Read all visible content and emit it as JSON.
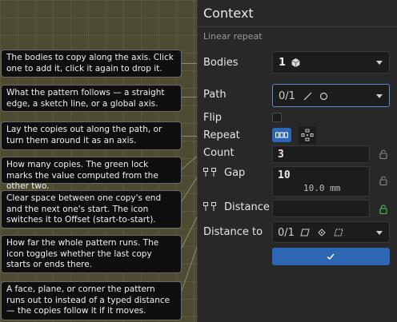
{
  "panel": {
    "title": "Context",
    "subtitle": "Linear repeat"
  },
  "rows": {
    "bodies_label": "Bodies",
    "bodies_value": "1",
    "path_label": "Path",
    "path_value": "0/1",
    "flip_label": "Flip",
    "repeat_label": "Repeat",
    "count_label": "Count",
    "count_value": "3",
    "gap_label": "Gap",
    "gap_value": "10",
    "gap_computed": "10.0 mm",
    "distance_label": "Distance",
    "distance_value": "",
    "distance_to_label": "Distance to",
    "distance_to_value": "0/1"
  },
  "tooltips": [
    "The bodies to copy along the axis. Click one to add it, click it again to drop it.",
    "What the pattern follows — a straight edge, a sketch line, or a global axis.",
    "Lay the copies out along the path, or turn them around it as an axis.",
    "How many copies. The green lock marks the value computed from the other two.",
    "Clear space between one copy's end and the next one's start. The icon switches it to Offset (start-to-start).",
    "How far the whole pattern runs. The icon toggles whether the last copy starts or ends there.",
    "A face, plane, or corner the pattern runs out to instead of a typed distance — the copies follow it if it moves."
  ],
  "colors": {
    "accent": "#2f66b3",
    "lock_active": "#4caf50",
    "focus": "#5b8ad0"
  }
}
